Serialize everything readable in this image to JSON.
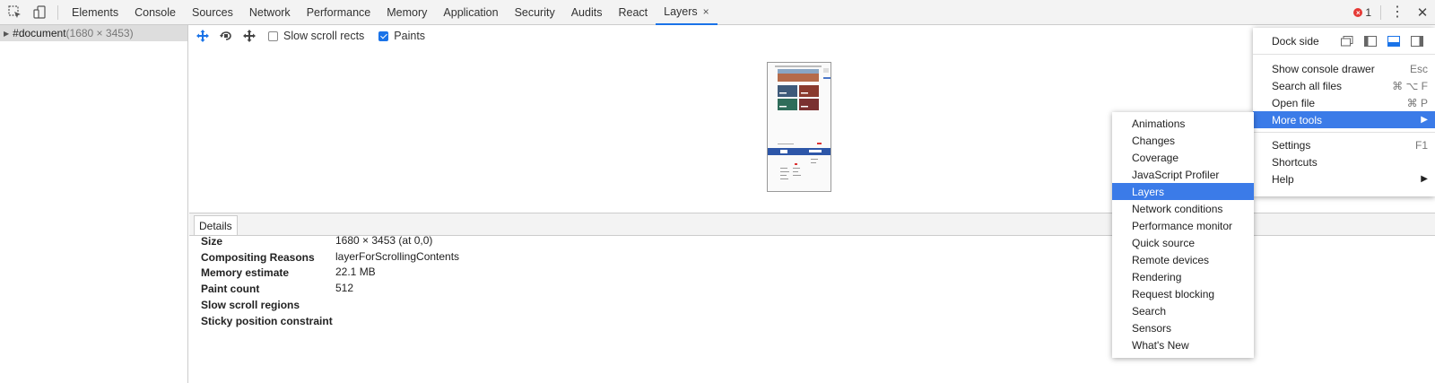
{
  "toolbar": {
    "tabs": [
      "Elements",
      "Console",
      "Sources",
      "Network",
      "Performance",
      "Memory",
      "Application",
      "Security",
      "Audits",
      "React",
      "Layers"
    ],
    "active_tab": "Layers",
    "close_glyph": "×",
    "error_count": "1",
    "error_glyph": "×",
    "kebab_glyph": "⋮",
    "close_devtools_glyph": "✕"
  },
  "tree": {
    "root_label": "#document",
    "root_dims": "(1680 × 3453)"
  },
  "layers_toolbar": {
    "slow_scroll_label": "Slow scroll rects",
    "slow_scroll_checked": false,
    "paints_label": "Paints",
    "paints_checked": true
  },
  "details": {
    "tab_label": "Details",
    "rows": [
      {
        "label": "Size",
        "value": "1680 × 3453 (at 0,0)"
      },
      {
        "label": "Compositing Reasons",
        "value": "layerForScrollingContents"
      },
      {
        "label": "Memory estimate",
        "value": "22.1 MB"
      },
      {
        "label": "Paint count",
        "value": "512"
      },
      {
        "label": "Slow scroll regions",
        "value": ""
      },
      {
        "label": "Sticky position constraint",
        "value": ""
      }
    ]
  },
  "main_menu": {
    "dock_side_label": "Dock side",
    "items": [
      {
        "label": "Show console drawer",
        "shortcut": "Esc"
      },
      {
        "label": "Search all files",
        "shortcut": "⌘ ⌥ F"
      },
      {
        "label": "Open file",
        "shortcut": "⌘ P"
      },
      {
        "label": "More tools",
        "shortcut": "▶"
      },
      {
        "label": "Settings",
        "shortcut": "F1"
      },
      {
        "label": "Shortcuts",
        "shortcut": ""
      },
      {
        "label": "Help",
        "shortcut": "▶"
      }
    ],
    "highlighted": "More tools"
  },
  "more_tools_menu": {
    "items": [
      "Animations",
      "Changes",
      "Coverage",
      "JavaScript Profiler",
      "Layers",
      "Network conditions",
      "Performance monitor",
      "Quick source",
      "Remote devices",
      "Rendering",
      "Request blocking",
      "Search",
      "Sensors",
      "What's New"
    ],
    "highlighted": "Layers"
  },
  "colors": {
    "accent": "#1a73e8",
    "menu_highlight": "#3b7be8",
    "error": "#e53935"
  }
}
